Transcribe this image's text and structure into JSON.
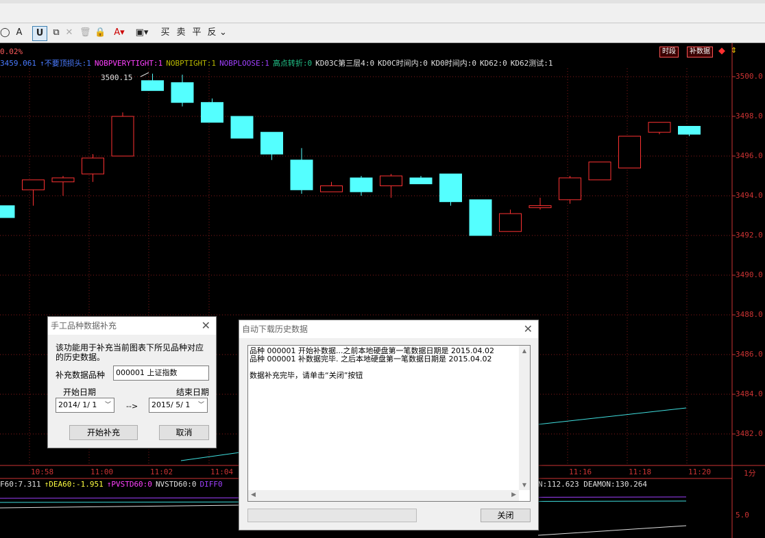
{
  "toolbar": {
    "items": [
      "A",
      "U",
      "✕",
      "买",
      "卖",
      "平",
      "反"
    ]
  },
  "chart": {
    "change_pct": "0.02%",
    "buttons": {
      "period": "时段",
      "fill": "补数据"
    },
    "indicator_line": [
      {
        "text": "3459.061",
        "color": "#4a7bff"
      },
      {
        "text": "↑不要顶损头:1",
        "color": "#4a7bff"
      },
      {
        "text": "NOBPVERYTIGHT:1",
        "color": "#ff40ff"
      },
      {
        "text": "NOBPTIGHT:1",
        "color": "#b8b800"
      },
      {
        "text": "NOBPLOOSE:1",
        "color": "#a040ff"
      },
      {
        "text": "高点转折:0",
        "color": "#22c48a"
      },
      {
        "text": "KD03C第三层4:0",
        "color": "#e0e0e0"
      },
      {
        "text": "KD0C时间内:0",
        "color": "#e0e0e0"
      },
      {
        "text": "KD0时间内:0",
        "color": "#e0e0e0"
      },
      {
        "text": "KD62:0",
        "color": "#e0e0e0"
      },
      {
        "text": "KD62测试:1",
        "color": "#e0e0e0"
      }
    ],
    "high_label": "3500.15",
    "y_labels": [
      "3500.0",
      "3498.0",
      "3496.0",
      "3494.0",
      "3492.0",
      "3490.0",
      "3488.0",
      "3486.0",
      "3484.0",
      "3482.0"
    ],
    "x_labels": [
      "10:58",
      "11:00",
      "11:02",
      "11:04",
      "11:16",
      "11:18",
      "11:20",
      "1分"
    ],
    "bottom_indicators": [
      {
        "text": "F60:7.311",
        "color": "#e0e0e0"
      },
      {
        "text": "↑DEA60:-1.951",
        "color": "#ffff40"
      },
      {
        "text": "↑PVSTD60:0",
        "color": "#ff40ff"
      },
      {
        "text": "NVSTD60:0",
        "color": "#e0e0e0"
      },
      {
        "text": "DIFF0",
        "color": "#a040ff"
      }
    ],
    "bottom_right": [
      "N:112.623",
      "DEAMON:130.264"
    ],
    "bottom_y": "5.0"
  },
  "chart_data": {
    "type": "candlestick",
    "ylim": [
      3481,
      3501
    ],
    "candles": [
      {
        "open": 3493.5,
        "close": 3492.9,
        "high": 3493.5,
        "low": 3492.9
      },
      {
        "open": 3494.3,
        "close": 3494.8,
        "high": 3494.8,
        "low": 3493.5
      },
      {
        "open": 3494.7,
        "close": 3494.9,
        "high": 3495.0,
        "low": 3494.0
      },
      {
        "open": 3495.1,
        "close": 3495.9,
        "high": 3496.1,
        "low": 3494.7
      },
      {
        "open": 3496.0,
        "close": 3498.0,
        "high": 3498.2,
        "low": 3496.0
      },
      {
        "open": 3499.8,
        "close": 3499.3,
        "high": 3500.15,
        "low": 3499.3
      },
      {
        "open": 3499.7,
        "close": 3498.7,
        "high": 3500.1,
        "low": 3498.5
      },
      {
        "open": 3498.7,
        "close": 3497.7,
        "high": 3498.9,
        "low": 3497.7
      },
      {
        "open": 3498.0,
        "close": 3496.9,
        "high": 3498.0,
        "low": 3496.9
      },
      {
        "open": 3497.2,
        "close": 3496.1,
        "high": 3497.2,
        "low": 3495.8
      },
      {
        "open": 3495.8,
        "close": 3494.3,
        "high": 3496.4,
        "low": 3494.1
      },
      {
        "open": 3494.2,
        "close": 3494.5,
        "high": 3494.7,
        "low": 3494.2
      },
      {
        "open": 3494.9,
        "close": 3494.2,
        "high": 3495.0,
        "low": 3494.0
      },
      {
        "open": 3494.5,
        "close": 3495.0,
        "high": 3495.1,
        "low": 3493.9
      },
      {
        "open": 3494.9,
        "close": 3494.6,
        "high": 3495.0,
        "low": 3494.6
      },
      {
        "open": 3495.1,
        "close": 3493.7,
        "high": 3495.1,
        "low": 3493.5
      },
      {
        "open": 3493.8,
        "close": 3492.0,
        "high": 3493.8,
        "low": 3492.0
      },
      {
        "open": 3492.2,
        "close": 3493.1,
        "high": 3493.3,
        "low": 3492.2
      },
      {
        "open": 3493.4,
        "close": 3493.5,
        "high": 3493.9,
        "low": 3493.3
      },
      {
        "open": 3493.8,
        "close": 3494.9,
        "high": 3495.0,
        "low": 3493.6
      },
      {
        "open": 3494.8,
        "close": 3495.7,
        "high": 3495.7,
        "low": 3494.8
      },
      {
        "open": 3495.4,
        "close": 3497.0,
        "high": 3497.0,
        "low": 3495.4
      },
      {
        "open": 3497.2,
        "close": 3497.7,
        "high": 3497.7,
        "low": 3497.1
      },
      {
        "open": 3497.5,
        "close": 3497.1,
        "high": 3497.5,
        "low": 3497.0
      }
    ]
  },
  "manual_dialog": {
    "title": "手工品种数据补充",
    "description_line1": "该功能用于补充当前图表下所见品种对应",
    "description_line2": "的历史数据。",
    "symbol_label": "补充数据品种",
    "symbol_value": "000001 上证指数",
    "start_label": "开始日期",
    "end_label": "结束日期",
    "start_value": "2014/ 1/ 1",
    "end_value": "2015/ 5/ 1",
    "arrow": "-->",
    "start_button": "开始补充",
    "cancel_button": "取消"
  },
  "download_dialog": {
    "title": "自动下载历史数据",
    "log_line1": "品种 000001 开始补数据...之前本地硬盘第一笔数据日期是 2015.04.02",
    "log_line2": "品种 000001 补数据完毕. 之后本地硬盘第一笔数据日期是 2015.04.02",
    "log_line3": "数据补充完毕，请单击“关闭”按钮",
    "close_button": "关闭"
  }
}
